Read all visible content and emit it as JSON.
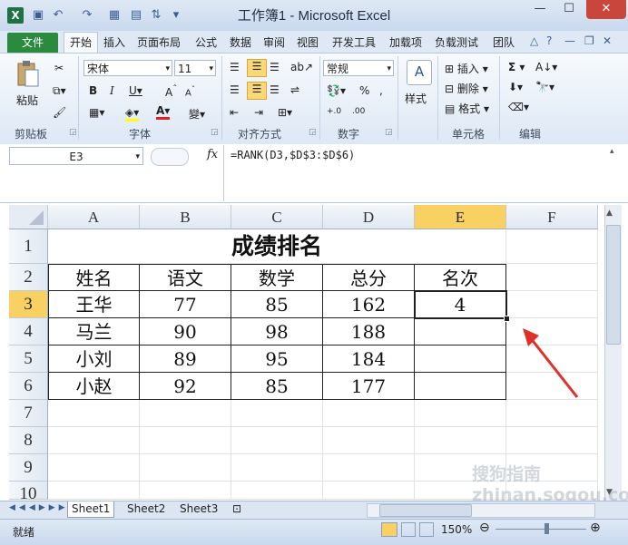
{
  "window": {
    "title": "工作簿1 - Microsoft Excel"
  },
  "ribbon": {
    "file_tab": "文件",
    "tabs": [
      "开始",
      "插入",
      "页面布局",
      "公式",
      "数据",
      "审阅",
      "视图",
      "开发工具",
      "加载项",
      "负载测试",
      "团队"
    ],
    "clipboard": {
      "paste": "粘贴",
      "label": "剪贴板"
    },
    "font": {
      "name": "宋体",
      "size": "11",
      "label": "字体"
    },
    "alignment": {
      "label": "对齐方式"
    },
    "number": {
      "format": "常规",
      "label": "数字"
    },
    "styles": {
      "label": "样式"
    },
    "cells": {
      "insert": "插入",
      "delete": "删除",
      "format": "格式",
      "label": "单元格"
    },
    "editing": {
      "label": "编辑"
    }
  },
  "formula_bar": {
    "name_box": "E3",
    "fx": "fx",
    "formula": "=RANK(D3,$D$3:$D$6)"
  },
  "grid": {
    "columns": [
      "A",
      "B",
      "C",
      "D",
      "E",
      "F"
    ],
    "rows": [
      "1",
      "2",
      "3",
      "4",
      "5",
      "6",
      "7",
      "8",
      "9",
      "10"
    ],
    "selected_cell": "E3",
    "title": "成绩排名",
    "headers": [
      "姓名",
      "语文",
      "数学",
      "总分",
      "名次"
    ],
    "data": [
      [
        "王华",
        "77",
        "85",
        "162",
        "4"
      ],
      [
        "马兰",
        "90",
        "98",
        "188",
        ""
      ],
      [
        "小刘",
        "89",
        "95",
        "184",
        ""
      ],
      [
        "小赵",
        "92",
        "85",
        "177",
        ""
      ]
    ]
  },
  "sheets": [
    "Sheet1",
    "Sheet2",
    "Sheet3"
  ],
  "status": {
    "ready": "就绪",
    "zoom": "150%"
  },
  "watermark": "搜狗指南 zhinan.sogou.com",
  "colors": {
    "accent_green": "#2a8a3e",
    "selected_header": "#f8d162",
    "arrow": "#e0302c"
  }
}
